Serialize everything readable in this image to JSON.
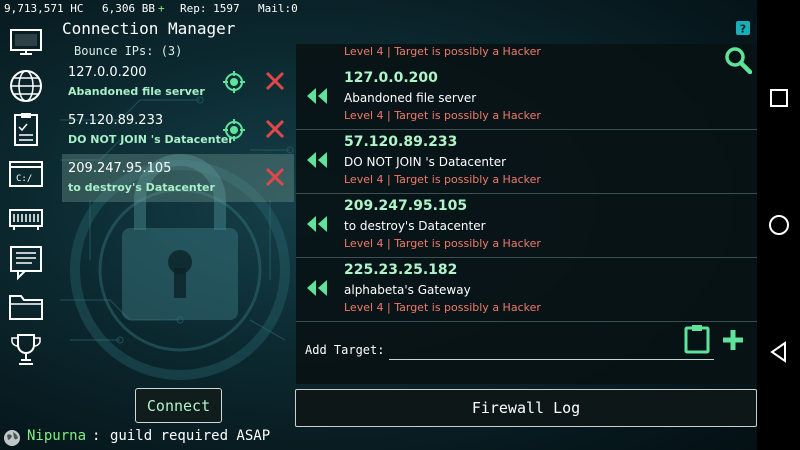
{
  "status_bar": {
    "hc": "9,713,571 HC",
    "bb": "6,306 BB",
    "bb_plus": "+",
    "rep": "Rep: 1597",
    "mail": "Mail:0"
  },
  "title": "Connection Manager",
  "bounce": {
    "label": "Bounce IPs: (3)",
    "items": [
      {
        "ip": "127.0.0.200",
        "owner": "Abandoned file server",
        "has_target_icon": true,
        "selected": false
      },
      {
        "ip": "57.120.89.233",
        "owner": "DO NOT JOIN 's Datacenter",
        "has_target_icon": true,
        "selected": false
      },
      {
        "ip": "209.247.95.105",
        "owner": "to destroy's Datacenter",
        "has_target_icon": false,
        "selected": true
      }
    ]
  },
  "targets": {
    "partial_warning": "Level 4 | Target is possibly a Hacker",
    "rows": [
      {
        "ip": "127.0.0.200",
        "owner": "Abandoned file server",
        "warning": "Level 4 | Target is possibly a Hacker"
      },
      {
        "ip": "57.120.89.233",
        "owner": "DO NOT JOIN 's Datacenter",
        "warning": "Level 4 | Target is possibly a Hacker"
      },
      {
        "ip": "209.247.95.105",
        "owner": "to destroy's Datacenter",
        "warning": "Level 4 | Target is possibly a Hacker"
      },
      {
        "ip": "225.23.25.182",
        "owner": "alphabeta's Gateway",
        "warning": "Level 4 | Target is possibly a Hacker"
      }
    ],
    "add_target_label": "Add Target:",
    "add_target_value": ""
  },
  "buttons": {
    "connect": "Connect",
    "firewall_log": "Firewall Log"
  },
  "chat": {
    "user": "Nipurna",
    "separator": ":",
    "message": "guild required ASAP"
  },
  "nav_icons": [
    "monitor-icon",
    "globe-icon",
    "clipboard-list-icon",
    "terminal-icon",
    "hardware-icon",
    "chat-icon",
    "folder-icon",
    "trophy-icon"
  ],
  "colors": {
    "accent_green": "#aef5c8",
    "warning_red": "#f07a6a",
    "remove_red": "#e04848",
    "icon_green": "#5fe39a"
  }
}
